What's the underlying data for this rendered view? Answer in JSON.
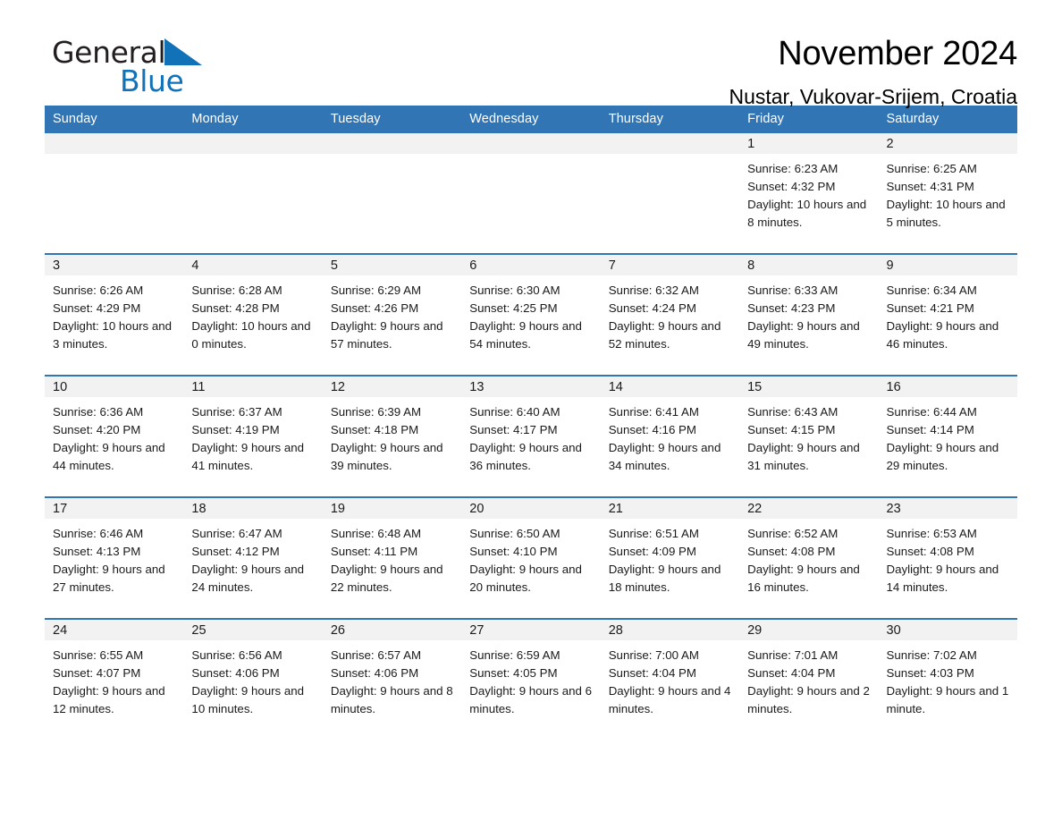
{
  "brand": {
    "name_part1": "General",
    "name_part2": "Blue",
    "triangle_icon": "triangle-icon",
    "accent_color": "#1272b8"
  },
  "header": {
    "title": "November 2024",
    "subtitle": "Nustar, Vukovar-Srijem, Croatia"
  },
  "theme": {
    "header_row_color": "#3275b5",
    "daynum_bg": "#f2f2f2",
    "text_color": "#1a1a1a"
  },
  "calendar": {
    "weekday_headers": [
      "Sunday",
      "Monday",
      "Tuesday",
      "Wednesday",
      "Thursday",
      "Friday",
      "Saturday"
    ],
    "labels": {
      "sunrise": "Sunrise:",
      "sunset": "Sunset:",
      "daylight": "Daylight:"
    },
    "weeks": [
      [
        {
          "day": "",
          "empty": true
        },
        {
          "day": "",
          "empty": true
        },
        {
          "day": "",
          "empty": true
        },
        {
          "day": "",
          "empty": true
        },
        {
          "day": "",
          "empty": true
        },
        {
          "day": "1",
          "sunrise": "Sunrise: 6:23 AM",
          "sunset": "Sunset: 4:32 PM",
          "daylight": "Daylight: 10 hours and 8 minutes."
        },
        {
          "day": "2",
          "sunrise": "Sunrise: 6:25 AM",
          "sunset": "Sunset: 4:31 PM",
          "daylight": "Daylight: 10 hours and 5 minutes."
        }
      ],
      [
        {
          "day": "3",
          "sunrise": "Sunrise: 6:26 AM",
          "sunset": "Sunset: 4:29 PM",
          "daylight": "Daylight: 10 hours and 3 minutes."
        },
        {
          "day": "4",
          "sunrise": "Sunrise: 6:28 AM",
          "sunset": "Sunset: 4:28 PM",
          "daylight": "Daylight: 10 hours and 0 minutes."
        },
        {
          "day": "5",
          "sunrise": "Sunrise: 6:29 AM",
          "sunset": "Sunset: 4:26 PM",
          "daylight": "Daylight: 9 hours and 57 minutes."
        },
        {
          "day": "6",
          "sunrise": "Sunrise: 6:30 AM",
          "sunset": "Sunset: 4:25 PM",
          "daylight": "Daylight: 9 hours and 54 minutes."
        },
        {
          "day": "7",
          "sunrise": "Sunrise: 6:32 AM",
          "sunset": "Sunset: 4:24 PM",
          "daylight": "Daylight: 9 hours and 52 minutes."
        },
        {
          "day": "8",
          "sunrise": "Sunrise: 6:33 AM",
          "sunset": "Sunset: 4:23 PM",
          "daylight": "Daylight: 9 hours and 49 minutes."
        },
        {
          "day": "9",
          "sunrise": "Sunrise: 6:34 AM",
          "sunset": "Sunset: 4:21 PM",
          "daylight": "Daylight: 9 hours and 46 minutes."
        }
      ],
      [
        {
          "day": "10",
          "sunrise": "Sunrise: 6:36 AM",
          "sunset": "Sunset: 4:20 PM",
          "daylight": "Daylight: 9 hours and 44 minutes."
        },
        {
          "day": "11",
          "sunrise": "Sunrise: 6:37 AM",
          "sunset": "Sunset: 4:19 PM",
          "daylight": "Daylight: 9 hours and 41 minutes."
        },
        {
          "day": "12",
          "sunrise": "Sunrise: 6:39 AM",
          "sunset": "Sunset: 4:18 PM",
          "daylight": "Daylight: 9 hours and 39 minutes."
        },
        {
          "day": "13",
          "sunrise": "Sunrise: 6:40 AM",
          "sunset": "Sunset: 4:17 PM",
          "daylight": "Daylight: 9 hours and 36 minutes."
        },
        {
          "day": "14",
          "sunrise": "Sunrise: 6:41 AM",
          "sunset": "Sunset: 4:16 PM",
          "daylight": "Daylight: 9 hours and 34 minutes."
        },
        {
          "day": "15",
          "sunrise": "Sunrise: 6:43 AM",
          "sunset": "Sunset: 4:15 PM",
          "daylight": "Daylight: 9 hours and 31 minutes."
        },
        {
          "day": "16",
          "sunrise": "Sunrise: 6:44 AM",
          "sunset": "Sunset: 4:14 PM",
          "daylight": "Daylight: 9 hours and 29 minutes."
        }
      ],
      [
        {
          "day": "17",
          "sunrise": "Sunrise: 6:46 AM",
          "sunset": "Sunset: 4:13 PM",
          "daylight": "Daylight: 9 hours and 27 minutes."
        },
        {
          "day": "18",
          "sunrise": "Sunrise: 6:47 AM",
          "sunset": "Sunset: 4:12 PM",
          "daylight": "Daylight: 9 hours and 24 minutes."
        },
        {
          "day": "19",
          "sunrise": "Sunrise: 6:48 AM",
          "sunset": "Sunset: 4:11 PM",
          "daylight": "Daylight: 9 hours and 22 minutes."
        },
        {
          "day": "20",
          "sunrise": "Sunrise: 6:50 AM",
          "sunset": "Sunset: 4:10 PM",
          "daylight": "Daylight: 9 hours and 20 minutes."
        },
        {
          "day": "21",
          "sunrise": "Sunrise: 6:51 AM",
          "sunset": "Sunset: 4:09 PM",
          "daylight": "Daylight: 9 hours and 18 minutes."
        },
        {
          "day": "22",
          "sunrise": "Sunrise: 6:52 AM",
          "sunset": "Sunset: 4:08 PM",
          "daylight": "Daylight: 9 hours and 16 minutes."
        },
        {
          "day": "23",
          "sunrise": "Sunrise: 6:53 AM",
          "sunset": "Sunset: 4:08 PM",
          "daylight": "Daylight: 9 hours and 14 minutes."
        }
      ],
      [
        {
          "day": "24",
          "sunrise": "Sunrise: 6:55 AM",
          "sunset": "Sunset: 4:07 PM",
          "daylight": "Daylight: 9 hours and 12 minutes."
        },
        {
          "day": "25",
          "sunrise": "Sunrise: 6:56 AM",
          "sunset": "Sunset: 4:06 PM",
          "daylight": "Daylight: 9 hours and 10 minutes."
        },
        {
          "day": "26",
          "sunrise": "Sunrise: 6:57 AM",
          "sunset": "Sunset: 4:06 PM",
          "daylight": "Daylight: 9 hours and 8 minutes."
        },
        {
          "day": "27",
          "sunrise": "Sunrise: 6:59 AM",
          "sunset": "Sunset: 4:05 PM",
          "daylight": "Daylight: 9 hours and 6 minutes."
        },
        {
          "day": "28",
          "sunrise": "Sunrise: 7:00 AM",
          "sunset": "Sunset: 4:04 PM",
          "daylight": "Daylight: 9 hours and 4 minutes."
        },
        {
          "day": "29",
          "sunrise": "Sunrise: 7:01 AM",
          "sunset": "Sunset: 4:04 PM",
          "daylight": "Daylight: 9 hours and 2 minutes."
        },
        {
          "day": "30",
          "sunrise": "Sunrise: 7:02 AM",
          "sunset": "Sunset: 4:03 PM",
          "daylight": "Daylight: 9 hours and 1 minute."
        }
      ]
    ]
  }
}
